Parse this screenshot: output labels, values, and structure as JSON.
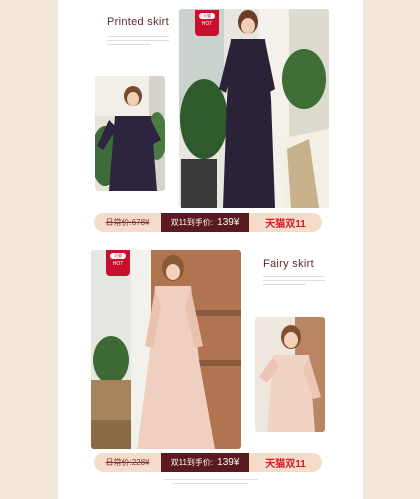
{
  "section1": {
    "title": "Printed skirt",
    "badge": {
      "logo": "天猫",
      "label": "HOT"
    },
    "price": {
      "regular_label": "日常价:678¥",
      "sale_label": "双11到手价:",
      "sale_price": "139¥",
      "campaign": "天猫双11"
    }
  },
  "section2": {
    "title": "Fairy skirt",
    "badge": {
      "logo": "天猫",
      "label": "HOT"
    },
    "price": {
      "regular_label": "日常价:228¥",
      "sale_label": "双11到手价:",
      "sale_price": "139¥",
      "campaign": "天猫双11"
    }
  },
  "colors": {
    "background": "#f3e5d7",
    "accent_dark": "#5b1a1f",
    "accent_red": "#c8102e",
    "price_pill": "#f4dcc9"
  }
}
